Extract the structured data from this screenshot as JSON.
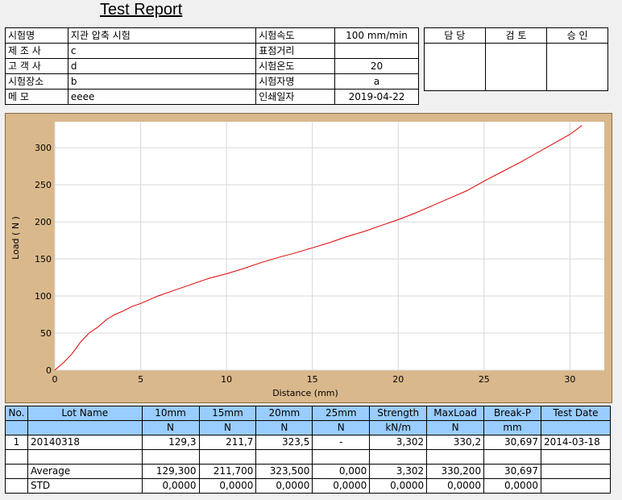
{
  "report": {
    "title": "Test Report"
  },
  "info": [
    [
      "시험명",
      "지관 압축 시험",
      "시험속도",
      "100 mm/min"
    ],
    [
      "제 조 사",
      "c",
      "표점거리",
      ""
    ],
    [
      "고 객 사",
      "d",
      "시험온도",
      "20"
    ],
    [
      "시험장소",
      "b",
      "시험자명",
      "a"
    ],
    [
      "메 모",
      "eeee",
      "인쇄일자",
      "2019-04-22"
    ]
  ],
  "approval": {
    "headers": [
      "담 당",
      "검 토",
      "승 인"
    ]
  },
  "chart_data": {
    "type": "line",
    "xlabel": "Distance (mm)",
    "ylabel": "Load ( N )",
    "xlim": [
      0,
      32
    ],
    "ylim": [
      0,
      335
    ],
    "xticks": [
      0,
      5,
      10,
      15,
      20,
      25,
      30
    ],
    "yticks": [
      0,
      50,
      100,
      150,
      200,
      250,
      300
    ],
    "grid": true,
    "series": [
      {
        "color": "#dd0000",
        "x": [
          0,
          0.5,
          1.0,
          1.5,
          2.0,
          2.5,
          3.0,
          3.5,
          4.0,
          4.5,
          5.0,
          6.0,
          7.0,
          8.0,
          9.0,
          10.0,
          11.0,
          12.0,
          13.0,
          14.0,
          15.0,
          16.0,
          17.0,
          18.0,
          19.0,
          20.0,
          21.0,
          22.0,
          23.0,
          24.0,
          25.0,
          26.0,
          27.0,
          28.0,
          29.0,
          30.0,
          30.7
        ],
        "y": [
          0,
          10,
          22,
          38,
          50,
          58,
          68,
          75,
          80,
          86,
          90,
          100,
          108,
          116,
          124,
          130,
          137,
          145,
          152,
          158,
          165,
          172,
          180,
          187,
          195,
          203,
          212,
          222,
          232,
          242,
          255,
          267,
          279,
          292,
          305,
          318,
          330
        ]
      }
    ]
  },
  "results": {
    "headers": [
      "No.",
      "Lot Name",
      "10mm",
      "15mm",
      "20mm",
      "25mm",
      "Strength",
      "MaxLoad",
      "Break-P",
      "Test Date"
    ],
    "units": [
      "",
      "",
      "N",
      "N",
      "N",
      "N",
      "kN/m",
      "N",
      "mm",
      ""
    ],
    "rows": [
      [
        "1",
        "20140318",
        "129,3",
        "211,7",
        "323,5",
        "-",
        "3,302",
        "330,2",
        "30,697",
        "2014-03-18"
      ],
      [
        "",
        "",
        "",
        "",
        "",
        "",
        "",
        "",
        "",
        ""
      ],
      [
        "",
        "Average",
        "129,300",
        "211,700",
        "323,500",
        "0,000",
        "3,302",
        "330,200",
        "30,697",
        ""
      ],
      [
        "",
        "STD",
        "0,0000",
        "0,0000",
        "0,0000",
        "0,0000",
        "0,0000",
        "0,0000",
        "0,0000",
        ""
      ]
    ]
  }
}
